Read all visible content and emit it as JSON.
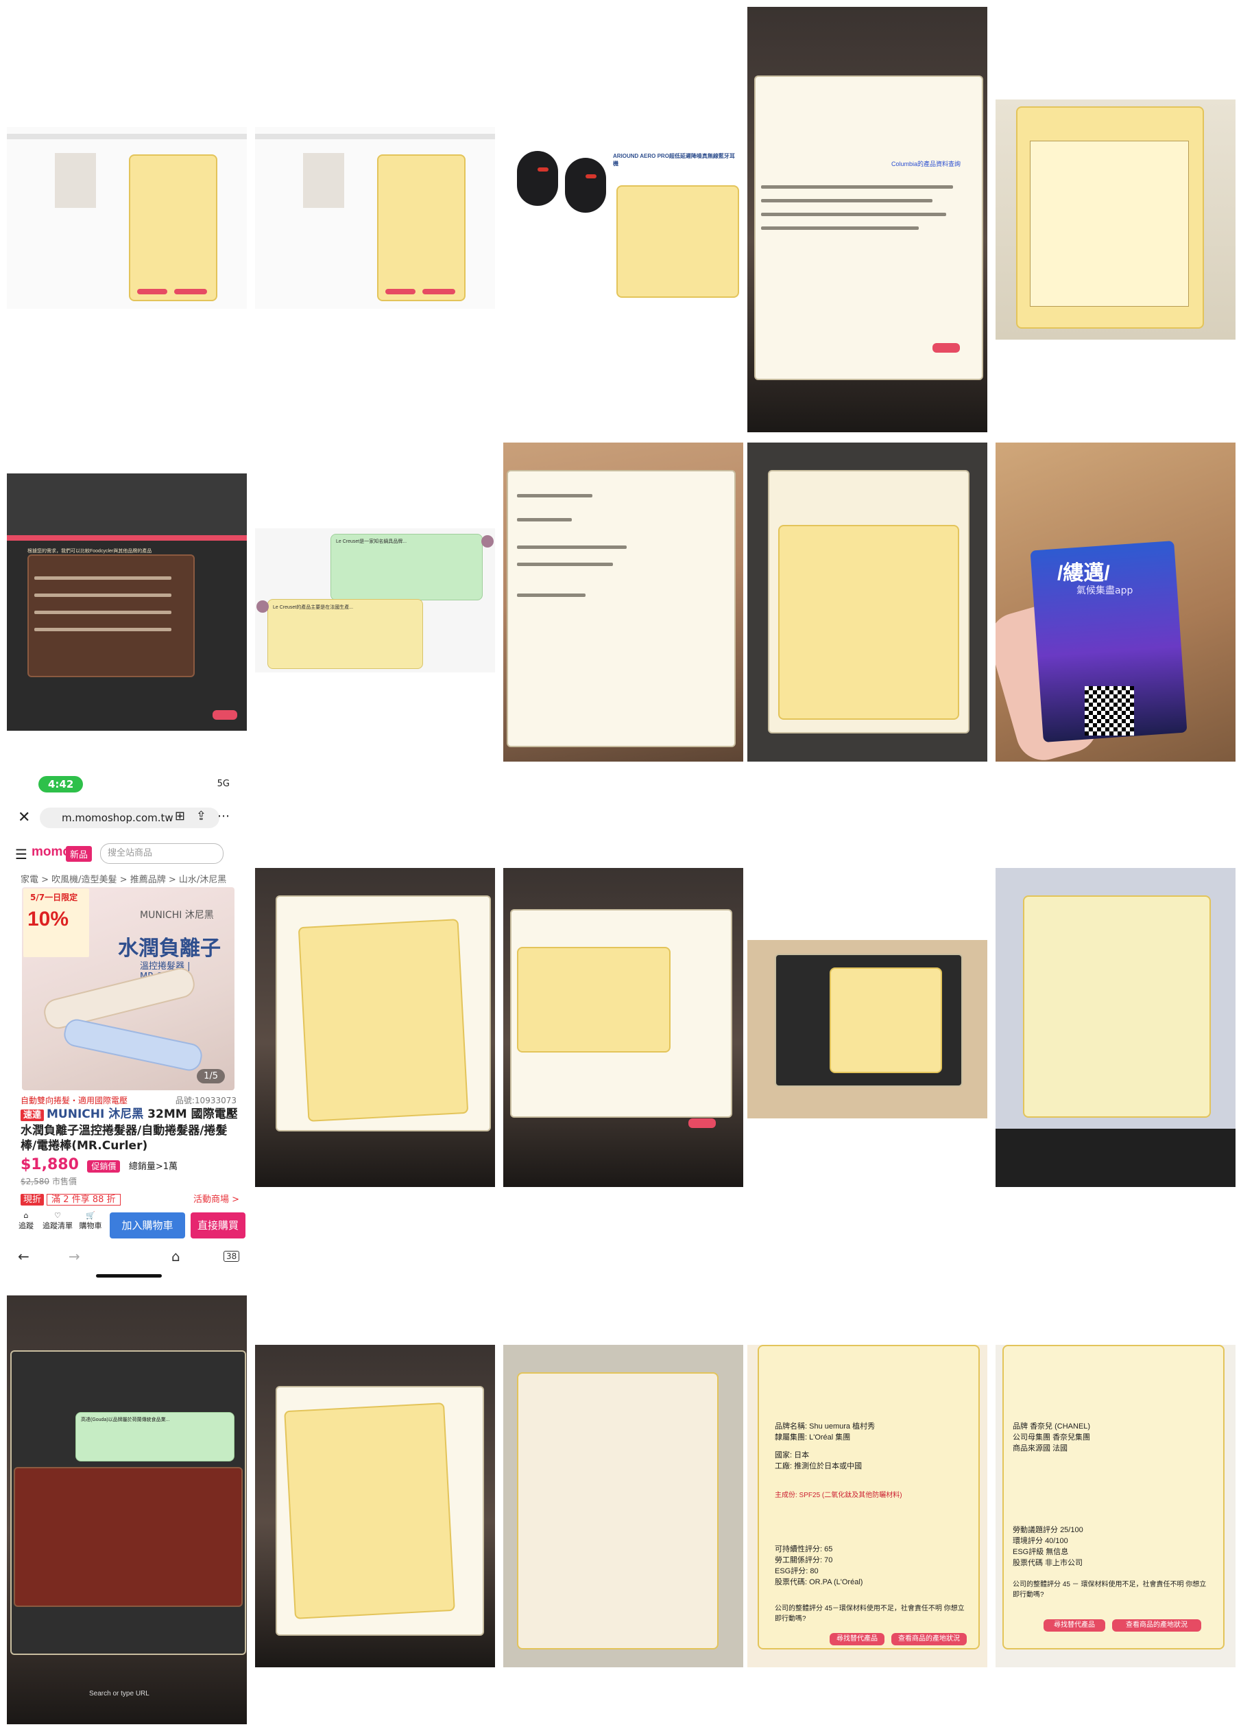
{
  "phone": {
    "time": "4:42",
    "signal": "5G",
    "url": "m.momoshop.com.tw",
    "logo": "momo",
    "new_tag": "新品",
    "search_placeholder": "搜全站商品",
    "breadcrumb": "家電 > 吹風機/造型美髮 > 推薦品牌 > 山水/沐尼黑",
    "promo_date": "5/7一日限定",
    "promo_percent": "10%",
    "product_banner_brand": "MUNICHI 沐尼黑",
    "product_banner_title": "水潤負離子",
    "product_banner_sub": "溫控捲髮器 | MR.Curler",
    "image_counter": "1/5",
    "category_link": "自動雙向捲髮・適用國際電壓",
    "product_id": "品號:10933073",
    "fast_tag": "速達",
    "product_brand": "MUNICHI 沐尼黑",
    "product_title": "32MM 國際電壓水潤負離子溫控捲髮器/自動捲髮器/捲髮棒/電捲棒(MR.Curler)",
    "price": "$1,880",
    "promo_price_label": "促銷價",
    "sold": "總銷量>1萬",
    "old_price": "$2,580",
    "old_price_suffix": "市售價",
    "discount_tag": "現折",
    "discount_deal": "滿 2 件享 88 折",
    "activity_link": "活動商場 >",
    "mini_buttons": [
      "追蹤",
      "追蹤清單",
      "購物車"
    ],
    "cart_button": "加入購物車",
    "buy_button": "直接購買",
    "tab_count": "38"
  },
  "tiles": {
    "card_title": "/縷邁/",
    "card_subtitle": "氣候集盡app",
    "chat_tile": {
      "bubble_green": "Le Creuset是一家知名鍋具品牌...",
      "bubble_yellow": "Le Creuset的產品主要是在法國生產..."
    },
    "momo_earbuds_title": "ARIOUND AERO PRO超低延遲降噪真無線藍牙耳機",
    "columbia_title": "Columbia的產品資料查詢",
    "compare_prompt": "根據您的需求，我們可以比較Foodcycler與其他品牌的產品",
    "gouda_prompt": "高達(Gouda)以品牌屬於荷蘭傳統食品業...",
    "bottom_left_search": "Search or type URL",
    "brand_last": "香奈兒 (CHANEL)",
    "brand_last_group": "香奈兒集團",
    "brand_last_origin": "法國",
    "brand_last_score1": "25/100",
    "brand_last_score2": "40/100",
    "brand_last_esg": "無信息",
    "brand_last_code": "非上市公司",
    "brand_last_question": "公司的整體評分 45 － 環保材料使用不足，社會責任不明 你想立即行動嗎?",
    "brand_last_btn1": "尋找替代產品",
    "brand_last_btn2": "查看商品的產地狀況",
    "loreal_brand": "Shu uemura 植村秀",
    "loreal_group": "L'Oréal 集團",
    "loreal_origin": "日本",
    "loreal_factory": "推測位於日本或中國",
    "loreal_material": "主成份: SPF25 (二氧化鈦及其他防曬材料)",
    "loreal_score1": "65",
    "loreal_score2": "70",
    "loreal_esg": "80",
    "loreal_code": "OR.PA (L'Oréal)",
    "loreal_question": "公司的整體評分 45－環保材料使用不足，社會責任不明 你想立即行動嗎?",
    "loreal_btn1": "尋找替代產品",
    "loreal_btn2": "查看商品的產地狀況"
  },
  "colors": {
    "panel_yellow": "#f9e59a",
    "accent_pink": "#e6266f",
    "action_red": "#e64b63",
    "momo_blue": "#3b7ddd",
    "fast_red": "#e8323a"
  }
}
